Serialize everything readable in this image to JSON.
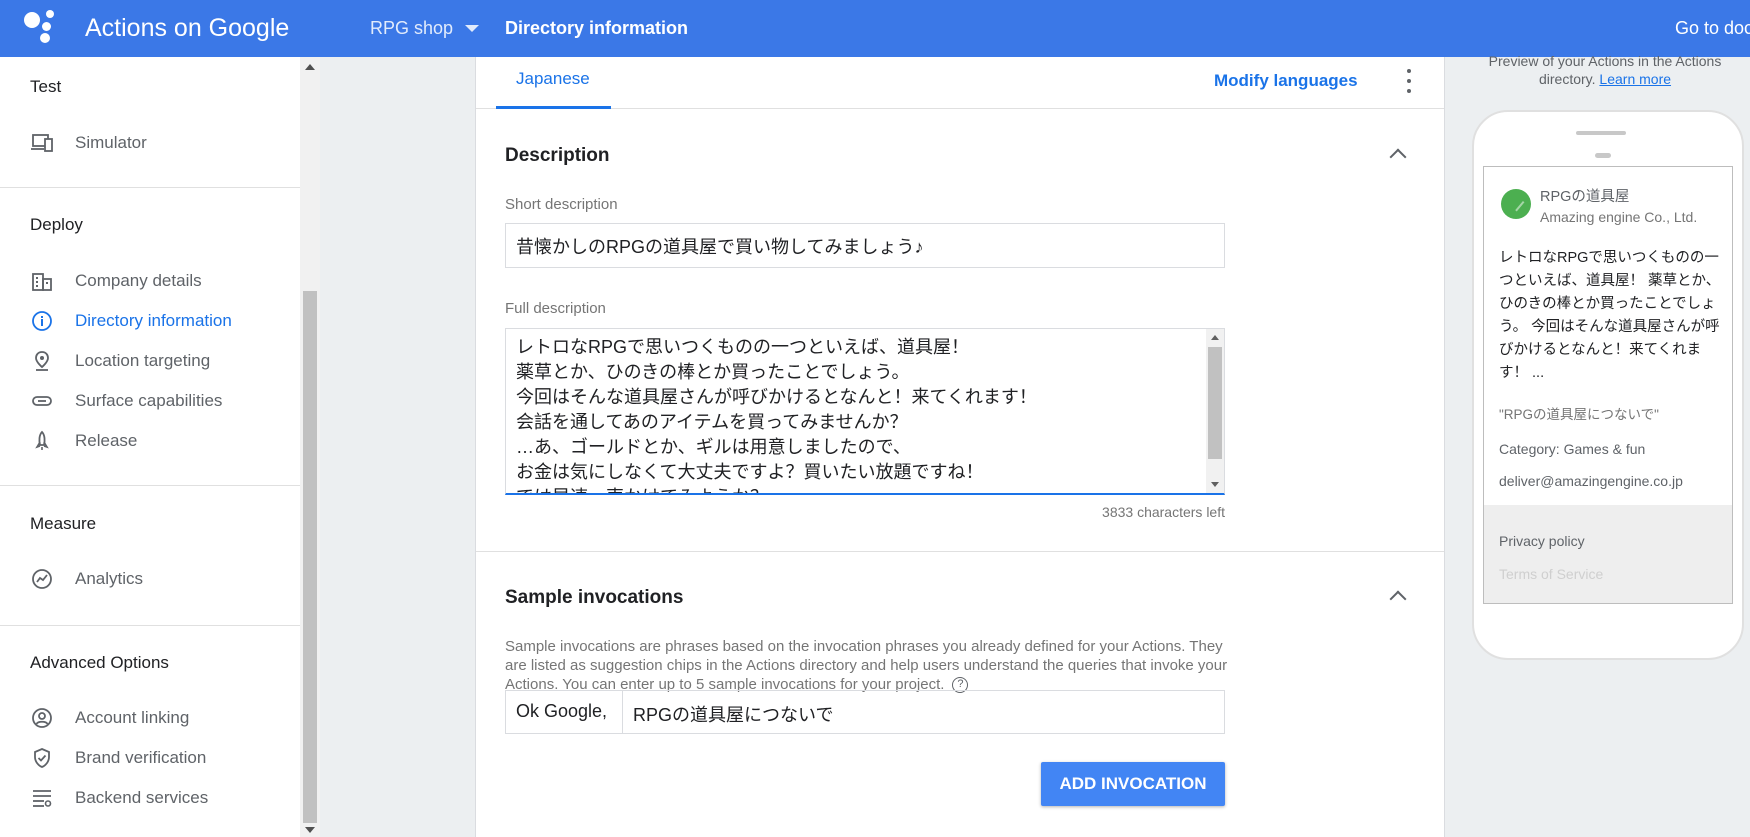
{
  "header": {
    "app_title": "Actions on Google",
    "project": "RPG shop",
    "breadcrumb": "Directory information",
    "goto": "Go to doc"
  },
  "sidebar": {
    "test_title": "Test",
    "simulator": "Simulator",
    "deploy_title": "Deploy",
    "deploy_items": [
      "Company details",
      "Directory information",
      "Location targeting",
      "Surface capabilities",
      "Release"
    ],
    "measure_title": "Measure",
    "analytics": "Analytics",
    "advanced_title": "Advanced Options",
    "advanced_items": [
      "Account linking",
      "Brand verification",
      "Backend services"
    ]
  },
  "tabs": {
    "language": "Japanese",
    "modify": "Modify languages"
  },
  "description": {
    "title": "Description",
    "short_label": "Short description",
    "short_value": "昔懐かしのRPGの道具屋で買い物してみましょう♪",
    "full_label": "Full description",
    "full_lines": [
      "レトロなRPGで思いつくものの一つといえば、道具屋！",
      "薬草とか、ひのきの棒とか買ったことでしょう。",
      "今回はそんな道具屋さんが呼びかけるとなんと！来てくれます！",
      "会話を通してあのアイテムを買ってみませんか？",
      "…あ、ゴールドとか、ギルは用意しましたので、",
      "お金は気にしなくて大丈夫ですよ？買いたい放題ですね！",
      "では早速、声かけてみようか？"
    ],
    "chars_left": "3833 characters left"
  },
  "invocations": {
    "title": "Sample invocations",
    "help": "Sample invocations are phrases based on the invocation phrases you already defined for your Actions. They are listed as suggestion chips in the Actions directory and help users understand the queries that invoke your Actions. You can enter up to 5 sample invocations for your project.",
    "prefix": "Ok Google,",
    "value": "RPGの道具屋につないで",
    "button": "ADD INVOCATION"
  },
  "preview": {
    "intro": "Preview of your Actions in the Actions directory.",
    "learn_more": "Learn more",
    "app_name": "RPGの道具屋",
    "company": "Amazing engine Co., Ltd.",
    "desc": "レトロなRPGで思いつくものの一つといえば、道具屋！ 薬草とか、ひのきの棒とか買ったことでしょう。 今回はそんな道具屋さんが呼びかけるとなんと！来てくれます！ ...",
    "invocation": "\"RPGの道具屋につないで\"",
    "category": "Category: Games & fun",
    "email": "deliver@amazingengine.co.jp",
    "privacy": "Privacy policy",
    "terms": "Terms of Service"
  },
  "colors": {
    "topbar": "#3b78e7",
    "accent": "#1a73e8",
    "button": "#4285f4"
  }
}
